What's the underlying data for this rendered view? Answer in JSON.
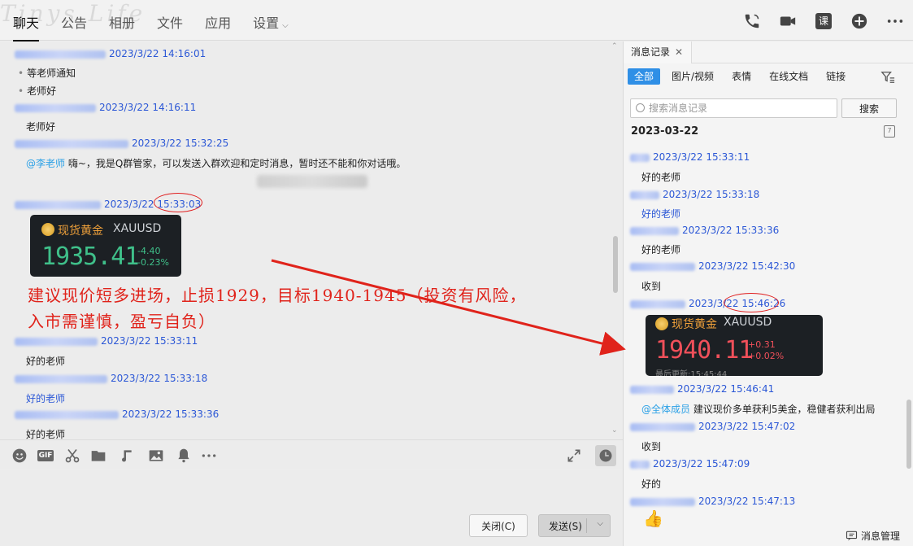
{
  "top": {
    "watermark": "Tinys Life",
    "tabs": [
      {
        "label": "聊天",
        "active": true
      },
      {
        "label": "公告"
      },
      {
        "label": "相册"
      },
      {
        "label": "文件"
      },
      {
        "label": "应用"
      },
      {
        "label": "设置"
      }
    ],
    "course_label": "课"
  },
  "chat": {
    "messages": {
      "m1_time": "2023/3/22 14:16:01",
      "m1_line1": "等老师通知",
      "m1_line2": "老师好",
      "m2_time": "2023/3/22 14:16:11",
      "m2_text": "老师好",
      "m3_time": "2023/3/22 15:32:25",
      "m3_mention": "@李老师",
      "m3_text": " 嗨~，我是Q群管家，可以发送入群欢迎和定时消息，暂时还不能和你对话哦。",
      "m4_time_date": "2023/3/22 ",
      "m4_time_clock": "15:33:03",
      "m5_time": "2023/3/22 15:33:11",
      "m5_text": "好的老师",
      "m6_time": "2023/3/22 15:33:18",
      "m6_text": "好的老师",
      "m7_time": "2023/3/22 15:33:36",
      "m7_text": "好的老师"
    },
    "card1": {
      "name": "现货黄金",
      "symbol": "XAUUSD",
      "price": "1935.41",
      "change": "-4.40",
      "change_pct": "-0.23%"
    },
    "annotation_line1": "建议现价短多进场，止损1929，目标1940-1945（投资有风险，",
    "annotation_line2": "入市需谨慎，盈亏自负）"
  },
  "input": {
    "close_label": "关闭(C)",
    "send_label": "发送(S)",
    "gif_label": "GIF"
  },
  "right": {
    "tab_label": "消息记录",
    "filters": [
      "全部",
      "图片/视频",
      "表情",
      "在线文档",
      "链接"
    ],
    "search_placeholder": "搜索消息记录",
    "search_button": "搜索",
    "date": "2023-03-22",
    "calendar_glyph": "7",
    "r1_time": "2023/3/22 15:33:11",
    "r1_text": "好的老师",
    "r2_time": "2023/3/22 15:33:18",
    "r2_text": "好的老师",
    "r3_time": "2023/3/22 15:33:36",
    "r3_text": "好的老师",
    "r4_time": "2023/3/22 15:42:30",
    "r4_text": "收到",
    "r5_time_date": "2023/3/22 ",
    "r5_time_clock": "15:46:26",
    "r6_time": "2023/3/22 15:46:41",
    "r6_mention": "@全体成员",
    "r6_text": " 建议现价多单获利5美金，稳健者获利出局",
    "r7_time": "2023/3/22 15:47:02",
    "r7_text": "收到",
    "r8_time": "2023/3/22 15:47:09",
    "r8_text": "好的",
    "r9_time": "2023/3/22 15:47:13",
    "manage_label": "消息管理",
    "card2": {
      "name": "现货黄金",
      "symbol": "XAUUSD",
      "price": "1940.11",
      "change": "+0.31",
      "change_pct": "+0.02%",
      "updated": "最后更新:15:45:44"
    }
  },
  "colors": {
    "accent": "#2f8fe6",
    "annotation_red": "#e0231b",
    "name_blue": "#2b57d6",
    "gold_orange": "#f0a13a",
    "price_green": "#3fc08a",
    "price_red": "#f0505a"
  }
}
